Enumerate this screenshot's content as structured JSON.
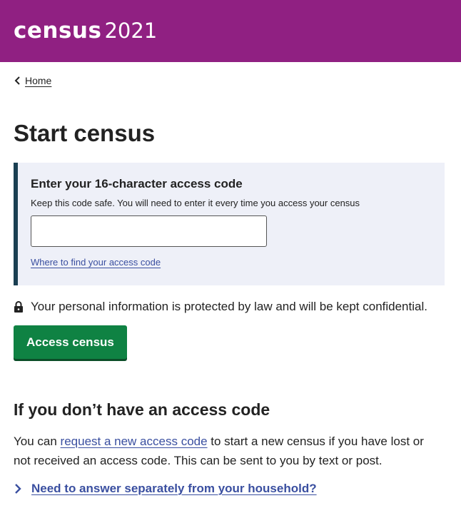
{
  "header": {
    "logo_word": "census",
    "logo_year": "2021",
    "background": "#902082"
  },
  "breadcrumb": {
    "home_label": "Home"
  },
  "page": {
    "title": "Start census"
  },
  "access_panel": {
    "label": "Enter your 16-character access code",
    "hint": "Keep this code safe. You will need to enter it every time you access your census",
    "input_value": "",
    "help_link": "Where to find your access code"
  },
  "legal": {
    "icon": "lock-icon",
    "text": "Your personal information is protected by law and will be kept confidential."
  },
  "primary_button": {
    "label": "Access census",
    "color": "#0f8243"
  },
  "no_code_section": {
    "heading": "If you don’t have an access code",
    "text_before": "You can ",
    "link": "request a new access code",
    "text_after": " to start a new census if you have lost or not received an access code. This can be sent to you by text or post."
  },
  "details": {
    "label": "Need to answer separately from your household?"
  }
}
